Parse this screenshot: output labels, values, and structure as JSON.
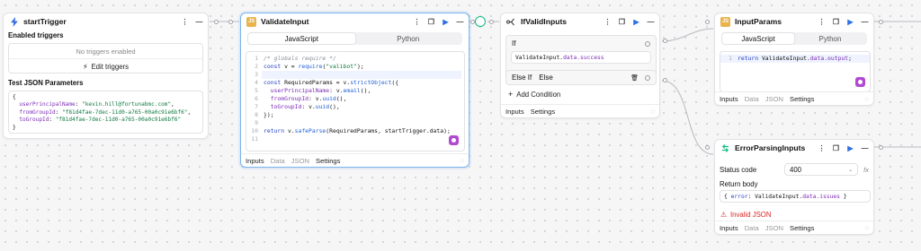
{
  "trigger": {
    "title": "startTrigger",
    "enabled_label": "Enabled triggers",
    "no_triggers": "No triggers enabled",
    "edit_label": "Edit triggers",
    "json_label": "Test JSON Parameters",
    "json_lines": [
      "{",
      "  userPrincipalName: \"kevin.hill@fortunabmc.com\",",
      "  fromGroupId: \"f81d4fae-7dec-11d0-a765-00a0c91e6bf6\",",
      "  toGroupId: \"f81d4fae-7dec-11d0-a765-00a0c91e6bf6\"",
      "}"
    ]
  },
  "validate": {
    "title": "ValidateInput",
    "tab_js": "JavaScript",
    "tab_py": "Python",
    "line_numbers": [
      "1",
      "2",
      "3",
      "4",
      "5",
      "6",
      "7",
      "8",
      "9",
      "10",
      "11"
    ],
    "code": {
      "l1": "/* globals require */",
      "l2_kw": "const",
      "l2_a": " v = ",
      "l2_fn": "require",
      "l2_b": "(",
      "l2_str": "\"valibot\"",
      "l2_c": ");",
      "l4_kw": "const",
      "l4_a": " RequiredParams = v.",
      "l4_fn": "strictObject",
      "l4_b": "({",
      "l5_prop": "userPrincipalName",
      "l5_a": ": v.",
      "l5_fn": "email",
      "l5_b": "(),",
      "l6_prop": "fromGroupId",
      "l6_a": ": v.",
      "l6_fn": "uuid",
      "l6_b": "(),",
      "l7_prop": "toGroupId",
      "l7_a": ": v.",
      "l7_fn": "uuid",
      "l7_b": "(),",
      "l8": "});",
      "l10_kw": "return",
      "l10_a": " v.",
      "l10_fn": "safeParse",
      "l10_b": "(RequiredParams, startTrigger.data);"
    },
    "footer": [
      "Inputs",
      "Data",
      "JSON",
      "Settings"
    ]
  },
  "ifvalid": {
    "title": "IfValidInputs",
    "if_label": "If",
    "if_expr_a": "ValidateInput.",
    "if_expr_b": "data.success",
    "elseif_label": "Else If",
    "else_label": "Else",
    "add_condition": "Add Condition",
    "footer": [
      "Inputs",
      "Settings"
    ]
  },
  "inputparams": {
    "title": "InputParams",
    "tab_js": "JavaScript",
    "tab_py": "Python",
    "line1": "1",
    "code_kw": "return",
    "code_a": " ValidateInput.",
    "code_prop": "data.output",
    "code_b": ";",
    "footer": [
      "Inputs",
      "Data",
      "JSON",
      "Settings"
    ]
  },
  "error": {
    "title": "ErrorParsingInputs",
    "status_label": "Status code",
    "status_value": "400",
    "fx": "fx",
    "body_label": "Return body",
    "body_a": "{ ",
    "body_kw": "error",
    "body_b": ": ValidateInput.",
    "body_prop": "data.issues",
    "body_c": " }",
    "invalid": "Invalid JSON",
    "footer": [
      "Inputs",
      "Data",
      "JSON",
      "Settings"
    ]
  },
  "colors": {
    "accent": "#2f6fe4",
    "selected": "#7db3ec",
    "success": "#10b981",
    "error": "#dc2626",
    "js_icon": "#e8b34a",
    "purple": "#b04ad0"
  }
}
